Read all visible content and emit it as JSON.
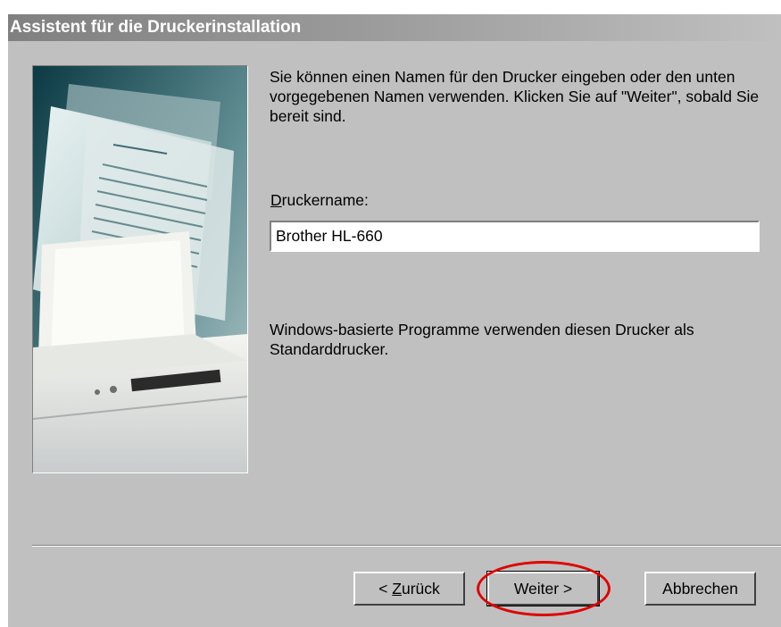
{
  "window": {
    "title": "Assistent für die Druckerinstallation"
  },
  "main": {
    "intro_text": "Sie können einen Namen für den Drucker eingeben oder den unten vorgegebenen Namen verwenden. Klicken Sie auf \"Weiter\", sobald Sie bereit sind.",
    "printer_name_label_mnemonic": "D",
    "printer_name_label_rest": "ruckername:",
    "printer_name_value": "Brother HL-660",
    "default_printer_text": "Windows-basierte Programme verwenden diesen Drucker als Standarddrucker."
  },
  "buttons": {
    "back_prefix": "< ",
    "back_mnemonic": "Z",
    "back_rest": "urück",
    "next_label": "Weiter >",
    "cancel_label": "Abbrechen"
  },
  "annotation": {
    "highlight_color": "#e00000",
    "highlighted_element": "next-button"
  },
  "colors": {
    "dialog_bg": "#c0c0c0",
    "titlebar_start": "#808080",
    "titlebar_end": "#c0c0c0"
  }
}
